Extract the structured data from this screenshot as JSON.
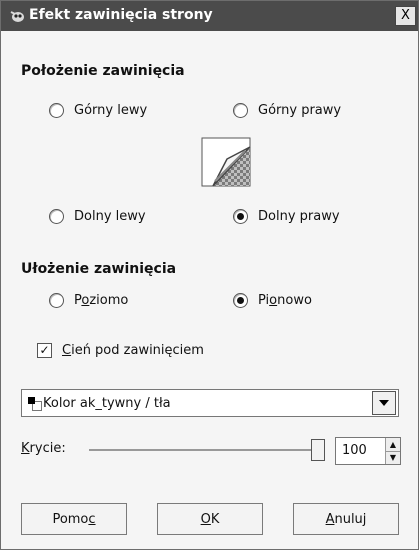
{
  "window": {
    "title": "Efekt zawinięcia strony",
    "close_label": "X"
  },
  "position_section": {
    "title": "Położenie zawinięcia",
    "options": [
      {
        "label": "Górny lewy",
        "checked": false
      },
      {
        "label": "Górny prawy",
        "checked": false
      },
      {
        "label": "Dolny lewy",
        "checked": false
      },
      {
        "label": "Dolny prawy",
        "checked": true
      }
    ]
  },
  "orientation_section": {
    "title": "Ułożenie zawinięcia",
    "options": [
      {
        "label_pre": "P",
        "label_ul": "o",
        "label_post": "ziomo",
        "checked": false
      },
      {
        "label_pre": "Pi",
        "label_ul": "o",
        "label_post": "nowo",
        "checked": true
      }
    ]
  },
  "shadow_checkbox": {
    "label_ul": "C",
    "label_post": "ień pod zawinięciem",
    "checked": true
  },
  "gradient_combo": {
    "value": "Kolor ak_tywny / tła"
  },
  "opacity": {
    "label_ul": "K",
    "label_post": "rycie:",
    "value": "100",
    "fraction": 1.0
  },
  "buttons": {
    "help": {
      "pre": "Pomo",
      "ul": "c",
      "post": ""
    },
    "ok": {
      "pre": "",
      "ul": "O",
      "post": "K"
    },
    "cancel": {
      "pre": "",
      "ul": "A",
      "post": "nuluj"
    }
  },
  "icons": {
    "title_icon": "gimp-wilber-icon",
    "preview": "page-curl-preview-icon",
    "combo_arrow": "chevron-down-icon"
  }
}
